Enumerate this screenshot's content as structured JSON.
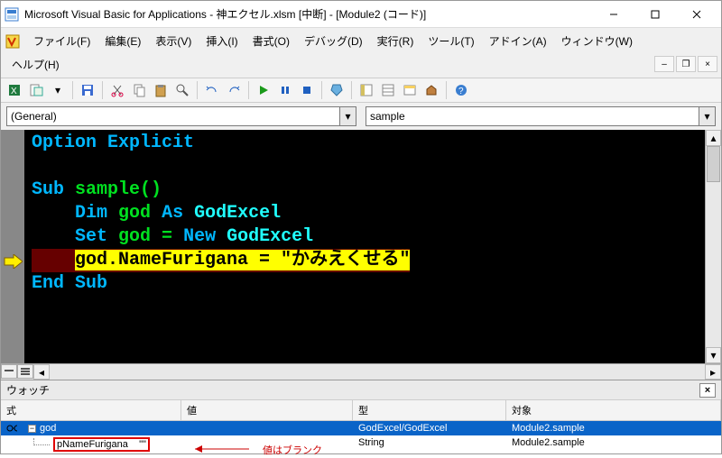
{
  "title": "Microsoft Visual Basic for Applications - 神エクセル.xlsm [中断] - [Module2 (コード)]",
  "menu": {
    "file": "ファイル(F)",
    "edit": "編集(E)",
    "view": "表示(V)",
    "insert": "挿入(I)",
    "format": "書式(O)",
    "debug": "デバッグ(D)",
    "run": "実行(R)",
    "tools": "ツール(T)",
    "addins": "アドイン(A)",
    "window": "ウィンドウ(W)",
    "help": "ヘルプ(H)"
  },
  "dropdowns": {
    "object": "(General)",
    "proc": "sample"
  },
  "code": {
    "l1_a": "Option",
    "l1_b": "Explicit",
    "l3_a": "Sub",
    "l3_b": "sample()",
    "l4_a": "Dim",
    "l4_b": "god",
    "l4_c": "As",
    "l4_d": "GodExcel",
    "l5_a": "Set",
    "l5_b": "god =",
    "l5_c": "New",
    "l5_d": "GodExcel",
    "l6": "god.NameFurigana = \"かみえくせる\"",
    "l7_a": "End",
    "l7_b": "Sub"
  },
  "watch": {
    "title": "ウォッチ",
    "headers": {
      "expr": "式",
      "value": "値",
      "type": "型",
      "scope": "対象"
    },
    "rows": [
      {
        "expr": "god",
        "value": "",
        "type": "GodExcel/GodExcel",
        "scope": "Module2.sample"
      },
      {
        "expr": "pNameFurigana",
        "value": "\"\"",
        "type": "String",
        "scope": "Module2.sample"
      }
    ],
    "annotation": "値はブランク"
  }
}
